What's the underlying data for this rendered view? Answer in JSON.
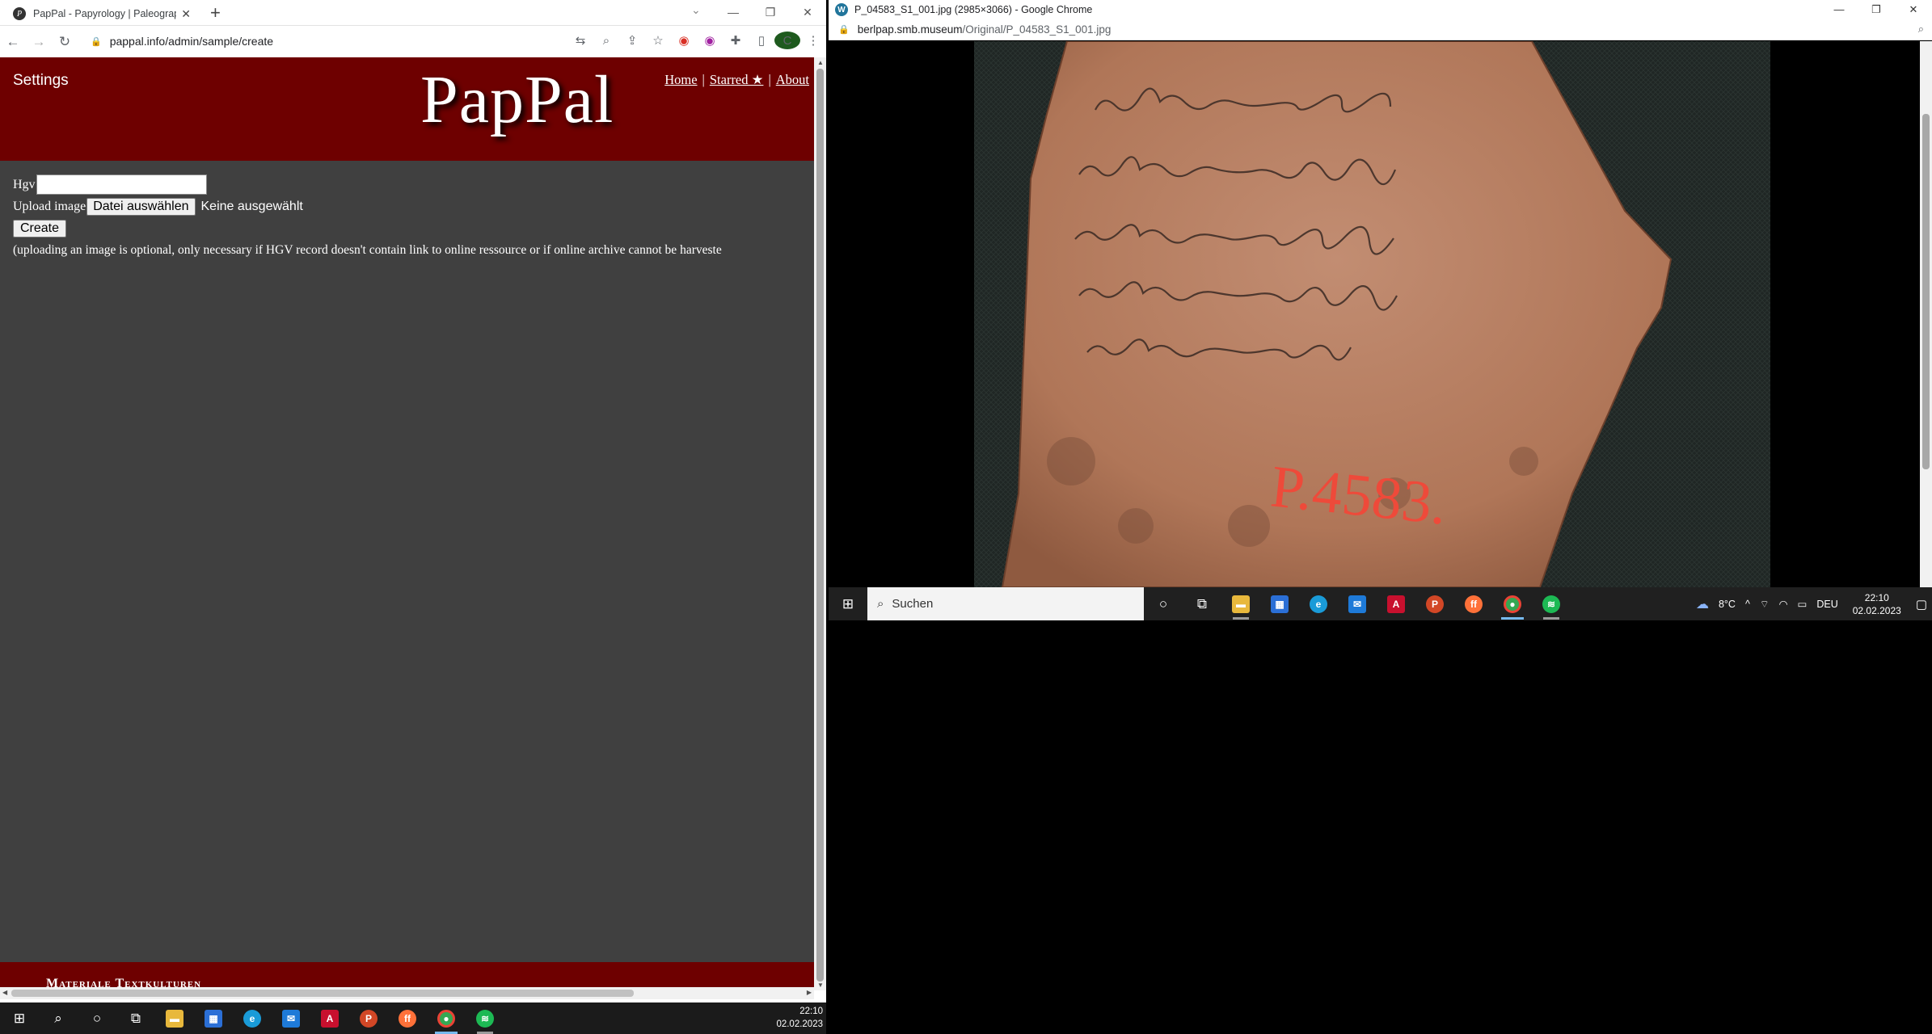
{
  "left_window": {
    "tab_title": "PapPal - Papyrology | Paleograph",
    "url": "pappal.info/admin/sample/create",
    "profile_initial": "C",
    "site": {
      "settings_label": "Settings",
      "logo_text": "PapPal",
      "nav": {
        "home": "Home",
        "starred": "Starred ★",
        "about": "About",
        "separator": "|"
      },
      "form": {
        "hgv_label": "Hgv",
        "hgv_value": "",
        "upload_label": "Upload image",
        "file_button_label": "Datei auswählen",
        "file_status": "Keine ausgewählt",
        "create_button_label": "Create",
        "note": "(uploading an image is optional, only necessary if HGV record doesn't contain link to online ressource or if online archive cannot be harveste"
      },
      "footer_text": "Materiale Textkulturen"
    },
    "taskbar": {
      "time": "22:10",
      "date": "02.02.2023"
    }
  },
  "right_window": {
    "title": "P_04583_S1_001.jpg (2985×3066) - Google Chrome",
    "url_host": "berlpap.smb.museum",
    "url_path": "/Original/P_04583_S1_001.jpg",
    "image_red_label": "P.4583.",
    "taskbar": {
      "search_placeholder": "Suchen",
      "weather": "8°C",
      "language": "DEU",
      "time": "22:10",
      "date": "02.02.2023"
    }
  },
  "colors": {
    "header_red": "#6e0000",
    "page_gray": "#404040",
    "taskbar_dark": "#1b1b1b",
    "ostracon_clay": "#b57c62"
  }
}
